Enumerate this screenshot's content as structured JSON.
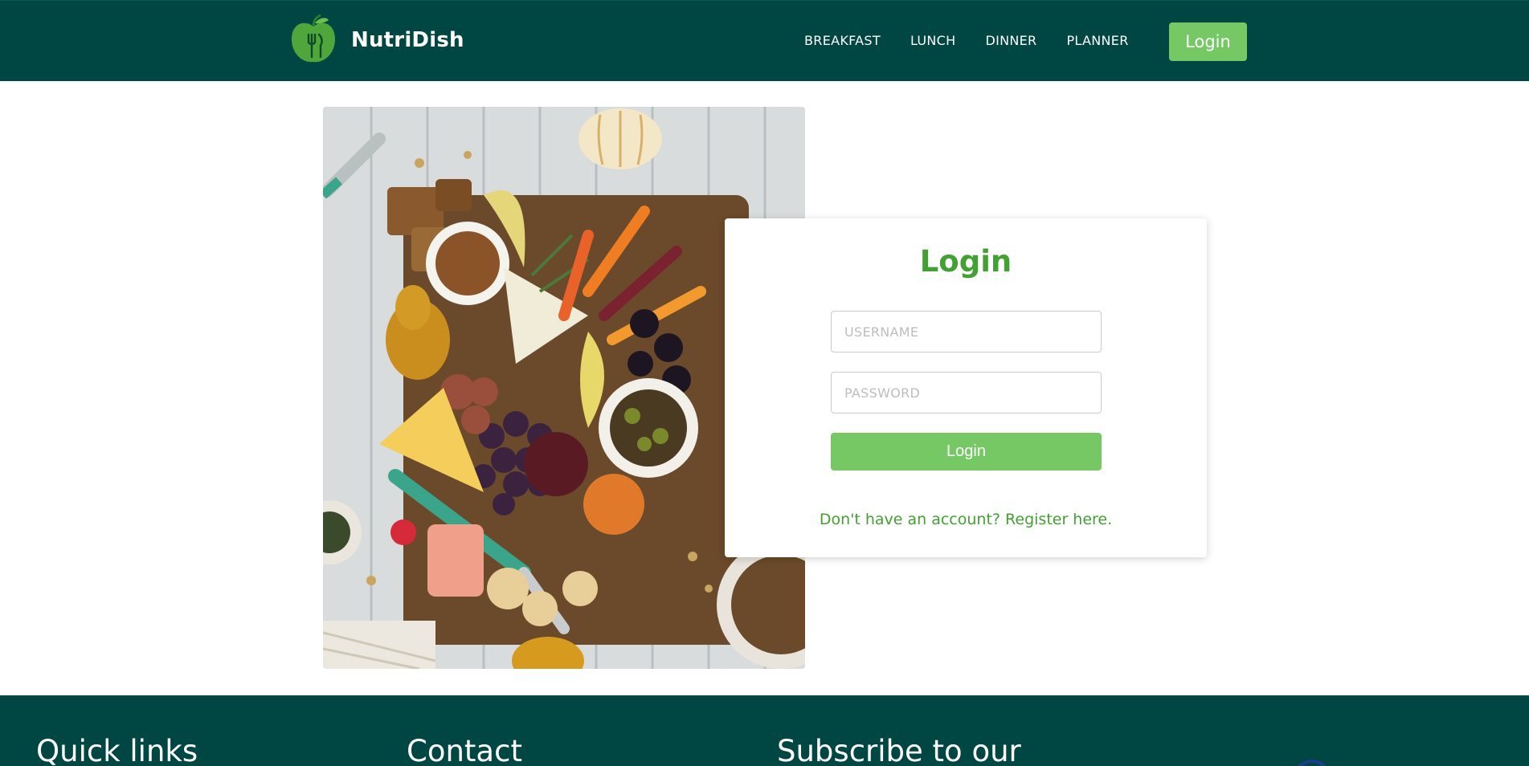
{
  "header": {
    "brand": "NutriDish",
    "nav": [
      "BREAKFAST",
      "LUNCH",
      "DINNER",
      "PLANNER"
    ],
    "login_button": "Login"
  },
  "login_card": {
    "title": "Login",
    "username_placeholder": "USERNAME",
    "password_placeholder": "PASSWORD",
    "submit_label": "Login",
    "register_text": "Don't have an account? Register here."
  },
  "footer": {
    "headings": [
      "Quick links",
      "Contact",
      "Subscribe to our"
    ]
  },
  "colors": {
    "header_bg": "#004643",
    "accent_green": "#76c865",
    "title_green": "#43a032"
  },
  "icons": {
    "logo": "apple-fork-logo-icon"
  }
}
